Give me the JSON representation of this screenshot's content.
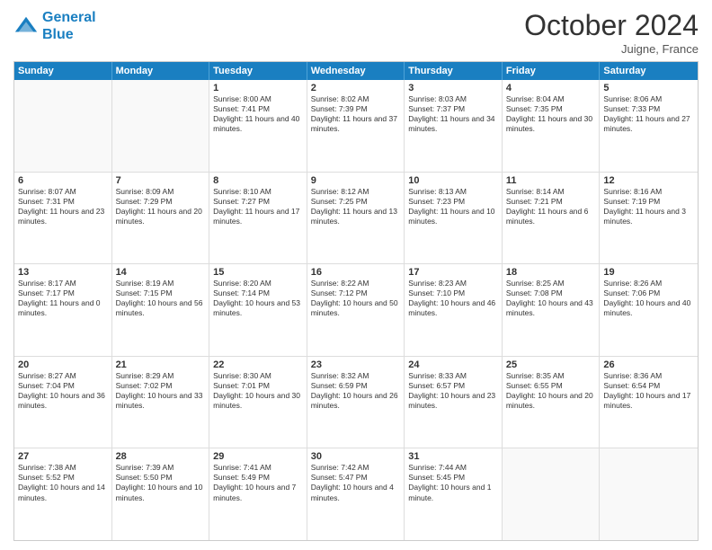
{
  "header": {
    "logo_line1": "General",
    "logo_line2": "Blue",
    "month": "October 2024",
    "location": "Juigne, France"
  },
  "weekdays": [
    "Sunday",
    "Monday",
    "Tuesday",
    "Wednesday",
    "Thursday",
    "Friday",
    "Saturday"
  ],
  "rows": [
    [
      {
        "day": "",
        "text": ""
      },
      {
        "day": "",
        "text": ""
      },
      {
        "day": "1",
        "text": "Sunrise: 8:00 AM\nSunset: 7:41 PM\nDaylight: 11 hours and 40 minutes."
      },
      {
        "day": "2",
        "text": "Sunrise: 8:02 AM\nSunset: 7:39 PM\nDaylight: 11 hours and 37 minutes."
      },
      {
        "day": "3",
        "text": "Sunrise: 8:03 AM\nSunset: 7:37 PM\nDaylight: 11 hours and 34 minutes."
      },
      {
        "day": "4",
        "text": "Sunrise: 8:04 AM\nSunset: 7:35 PM\nDaylight: 11 hours and 30 minutes."
      },
      {
        "day": "5",
        "text": "Sunrise: 8:06 AM\nSunset: 7:33 PM\nDaylight: 11 hours and 27 minutes."
      }
    ],
    [
      {
        "day": "6",
        "text": "Sunrise: 8:07 AM\nSunset: 7:31 PM\nDaylight: 11 hours and 23 minutes."
      },
      {
        "day": "7",
        "text": "Sunrise: 8:09 AM\nSunset: 7:29 PM\nDaylight: 11 hours and 20 minutes."
      },
      {
        "day": "8",
        "text": "Sunrise: 8:10 AM\nSunset: 7:27 PM\nDaylight: 11 hours and 17 minutes."
      },
      {
        "day": "9",
        "text": "Sunrise: 8:12 AM\nSunset: 7:25 PM\nDaylight: 11 hours and 13 minutes."
      },
      {
        "day": "10",
        "text": "Sunrise: 8:13 AM\nSunset: 7:23 PM\nDaylight: 11 hours and 10 minutes."
      },
      {
        "day": "11",
        "text": "Sunrise: 8:14 AM\nSunset: 7:21 PM\nDaylight: 11 hours and 6 minutes."
      },
      {
        "day": "12",
        "text": "Sunrise: 8:16 AM\nSunset: 7:19 PM\nDaylight: 11 hours and 3 minutes."
      }
    ],
    [
      {
        "day": "13",
        "text": "Sunrise: 8:17 AM\nSunset: 7:17 PM\nDaylight: 11 hours and 0 minutes."
      },
      {
        "day": "14",
        "text": "Sunrise: 8:19 AM\nSunset: 7:15 PM\nDaylight: 10 hours and 56 minutes."
      },
      {
        "day": "15",
        "text": "Sunrise: 8:20 AM\nSunset: 7:14 PM\nDaylight: 10 hours and 53 minutes."
      },
      {
        "day": "16",
        "text": "Sunrise: 8:22 AM\nSunset: 7:12 PM\nDaylight: 10 hours and 50 minutes."
      },
      {
        "day": "17",
        "text": "Sunrise: 8:23 AM\nSunset: 7:10 PM\nDaylight: 10 hours and 46 minutes."
      },
      {
        "day": "18",
        "text": "Sunrise: 8:25 AM\nSunset: 7:08 PM\nDaylight: 10 hours and 43 minutes."
      },
      {
        "day": "19",
        "text": "Sunrise: 8:26 AM\nSunset: 7:06 PM\nDaylight: 10 hours and 40 minutes."
      }
    ],
    [
      {
        "day": "20",
        "text": "Sunrise: 8:27 AM\nSunset: 7:04 PM\nDaylight: 10 hours and 36 minutes."
      },
      {
        "day": "21",
        "text": "Sunrise: 8:29 AM\nSunset: 7:02 PM\nDaylight: 10 hours and 33 minutes."
      },
      {
        "day": "22",
        "text": "Sunrise: 8:30 AM\nSunset: 7:01 PM\nDaylight: 10 hours and 30 minutes."
      },
      {
        "day": "23",
        "text": "Sunrise: 8:32 AM\nSunset: 6:59 PM\nDaylight: 10 hours and 26 minutes."
      },
      {
        "day": "24",
        "text": "Sunrise: 8:33 AM\nSunset: 6:57 PM\nDaylight: 10 hours and 23 minutes."
      },
      {
        "day": "25",
        "text": "Sunrise: 8:35 AM\nSunset: 6:55 PM\nDaylight: 10 hours and 20 minutes."
      },
      {
        "day": "26",
        "text": "Sunrise: 8:36 AM\nSunset: 6:54 PM\nDaylight: 10 hours and 17 minutes."
      }
    ],
    [
      {
        "day": "27",
        "text": "Sunrise: 7:38 AM\nSunset: 5:52 PM\nDaylight: 10 hours and 14 minutes."
      },
      {
        "day": "28",
        "text": "Sunrise: 7:39 AM\nSunset: 5:50 PM\nDaylight: 10 hours and 10 minutes."
      },
      {
        "day": "29",
        "text": "Sunrise: 7:41 AM\nSunset: 5:49 PM\nDaylight: 10 hours and 7 minutes."
      },
      {
        "day": "30",
        "text": "Sunrise: 7:42 AM\nSunset: 5:47 PM\nDaylight: 10 hours and 4 minutes."
      },
      {
        "day": "31",
        "text": "Sunrise: 7:44 AM\nSunset: 5:45 PM\nDaylight: 10 hours and 1 minute."
      },
      {
        "day": "",
        "text": ""
      },
      {
        "day": "",
        "text": ""
      }
    ]
  ]
}
